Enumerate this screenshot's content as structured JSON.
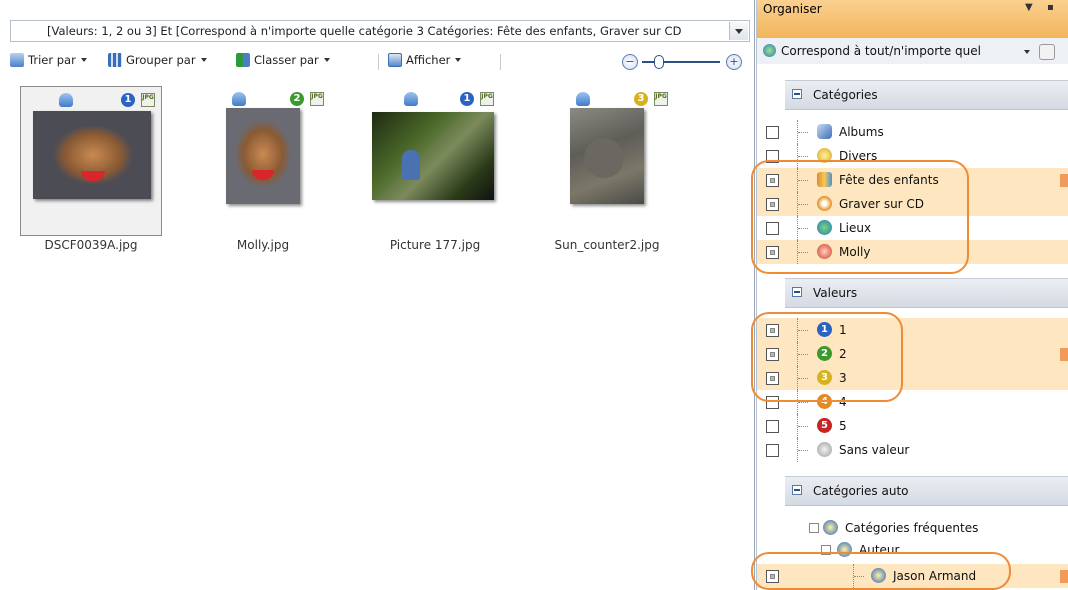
{
  "filter": {
    "text": "[Valeurs: 1, 2 ou 3] Et [Correspond à n'importe quelle catégorie 3 Catégories: Fête des enfants, Graver sur CD"
  },
  "toolbar": {
    "sort": "Trier par",
    "group": "Grouper par",
    "order": "Classer par",
    "view": "Afficher"
  },
  "zoom": {
    "minus": "−",
    "plus": "+"
  },
  "thumbnails": [
    {
      "name": "DSCF0039A.jpg",
      "rating": "1",
      "format": "JPG",
      "selected": true
    },
    {
      "name": "Molly.jpg",
      "rating": "2",
      "format": "JPG",
      "selected": false
    },
    {
      "name": "Picture 177.jpg",
      "rating": "1",
      "format": "JPG",
      "selected": false
    },
    {
      "name": "Sun_counter2.jpg",
      "rating": "3",
      "format": "JPG",
      "selected": false
    }
  ],
  "panel": {
    "title": "Organiser",
    "match": "Correspond à tout/n'importe quel",
    "sections": {
      "categories": "Catégories",
      "values": "Valeurs",
      "auto": "Catégories auto"
    },
    "categories": [
      {
        "label": "Albums",
        "checked": false,
        "highlighted": false,
        "icon": "albums-icon"
      },
      {
        "label": "Divers",
        "checked": false,
        "highlighted": false,
        "icon": "misc-icon"
      },
      {
        "label": "Fête des enfants",
        "checked": true,
        "highlighted": true,
        "icon": "children-icon"
      },
      {
        "label": "Graver sur CD",
        "checked": true,
        "highlighted": true,
        "icon": "burn-cd-icon"
      },
      {
        "label": "Lieux",
        "checked": false,
        "highlighted": false,
        "icon": "places-icon"
      },
      {
        "label": "Molly",
        "checked": true,
        "highlighted": true,
        "icon": "person-icon"
      }
    ],
    "values": [
      {
        "label": "1",
        "checked": true,
        "highlighted": true,
        "color": "#2a63c2"
      },
      {
        "label": "2",
        "checked": true,
        "highlighted": true,
        "color": "#3a9a2e"
      },
      {
        "label": "3",
        "checked": true,
        "highlighted": true,
        "color": "#d8b21e"
      },
      {
        "label": "4",
        "checked": false,
        "highlighted": false,
        "color": "#e48a20"
      },
      {
        "label": "5",
        "checked": false,
        "highlighted": false,
        "color": "#c92424"
      },
      {
        "label": "Sans valeur",
        "checked": false,
        "highlighted": false,
        "color": "#b5b5b5"
      }
    ],
    "auto": [
      {
        "label": "Catégories fréquentes"
      },
      {
        "label": "Auteur"
      },
      {
        "label": "Jason Armand",
        "checked": true,
        "highlighted": true
      }
    ]
  }
}
